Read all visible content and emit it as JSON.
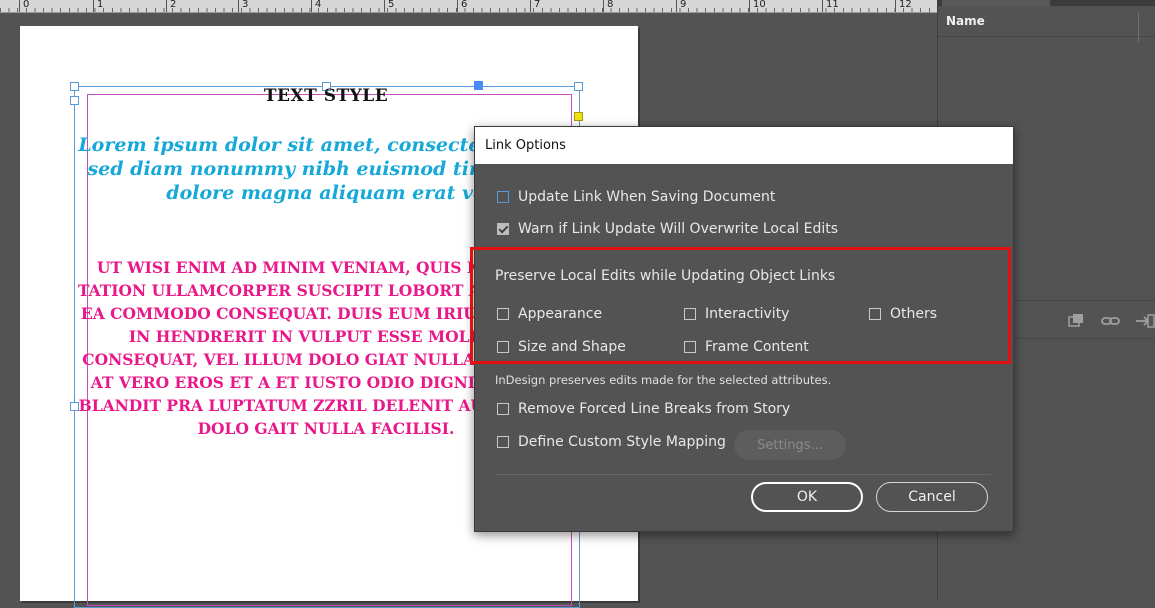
{
  "ruler": {
    "ticks": [
      "0",
      "1",
      "2",
      "3",
      "4",
      "5",
      "6",
      "7",
      "8",
      "9",
      "10",
      "11",
      "12"
    ]
  },
  "document": {
    "heading": "TEXT STYLE",
    "lorem_paragraph": "Lorem ipsum dolor sit amet, consectetuer elit, sed diam nonummy nibh euismod tin laoreet dolore magna aliquam erat vo",
    "caps_paragraph": "UT WISI ENIM AD MINIM VENIAM, QUIS NOSTR CI TATION ULLAMCORPER SUSCIPIT LOBORT ALIQUIP EX EA COMMODO CONSEQUAT. DUIS EUM IRIURE DOLOR IN HENDRERIT IN VULPUT ESSE MOLESTIE CONSEQUAT, VEL ILLUM DOLO GIAT NULLA FACILISIS AT VERO EROS ET A ET IUSTO ODIO DIGNISSIM QUI BLANDIT PRA LUPTATUM ZZRIL DELENIT AUGUE DUIS DOLO GAIT NULLA FACILISI."
  },
  "panel": {
    "column_name": "Name",
    "icons": [
      "relink-icon",
      "link-icon",
      "goto-link-icon"
    ]
  },
  "dialog": {
    "title": "Link Options",
    "update_link_label": "Update Link When Saving Document",
    "update_link_checked": false,
    "warn_label": "Warn if Link Update Will Overwrite Local Edits",
    "warn_checked": true,
    "preserve_section_label": "Preserve Local Edits while Updating Object Links",
    "preserve_options": {
      "appearance": "Appearance",
      "interactivity": "Interactivity",
      "others": "Others",
      "size_and_shape": "Size and Shape",
      "frame_content": "Frame Content"
    },
    "preserve_note": "InDesign preserves edits made for the selected attributes.",
    "remove_line_breaks_label": "Remove Forced Line Breaks from Story",
    "custom_style_label": "Define Custom Style Mapping",
    "settings_button": "Settings...",
    "ok_button": "OK",
    "cancel_button": "Cancel"
  },
  "colors": {
    "highlight": "#e21111",
    "lorem_text": "#15a8d8",
    "caps_text": "#e8178a",
    "frame_edge": "#5b9bd5"
  }
}
